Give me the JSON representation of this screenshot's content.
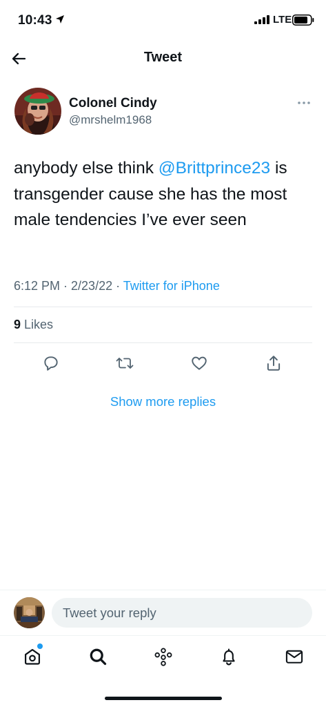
{
  "status_bar": {
    "time": "10:43",
    "network": "LTE"
  },
  "header": {
    "back_icon": "arrow-left-icon",
    "title": "Tweet"
  },
  "tweet": {
    "author_name": "Colonel Cindy",
    "author_handle": "@mrshelm1968",
    "text_before": "anybody else think ",
    "mention": "@Brittprince23",
    "text_after": " is transgender cause she has the most male tendencies I’ve ever seen",
    "timestamp": "6:12 PM · 2/23/22 · ",
    "source": "Twitter for iPhone",
    "likes_count": "9",
    "likes_label": "Likes"
  },
  "actions": [
    {
      "icon": "reply-icon"
    },
    {
      "icon": "retweet-icon"
    },
    {
      "icon": "like-icon"
    },
    {
      "icon": "share-icon"
    }
  ],
  "show_more_replies": "Show more replies",
  "reply_box": {
    "placeholder": "Tweet your reply"
  },
  "tab_bar": [
    {
      "icon": "home-icon"
    },
    {
      "icon": "search-icon"
    },
    {
      "icon": "spaces-icon"
    },
    {
      "icon": "notifications-icon"
    },
    {
      "icon": "messages-icon"
    }
  ],
  "colors": {
    "accent": "#1d9bf0",
    "text_primary": "#0f1419",
    "text_secondary": "#536471",
    "divider": "#e7e9ec"
  }
}
